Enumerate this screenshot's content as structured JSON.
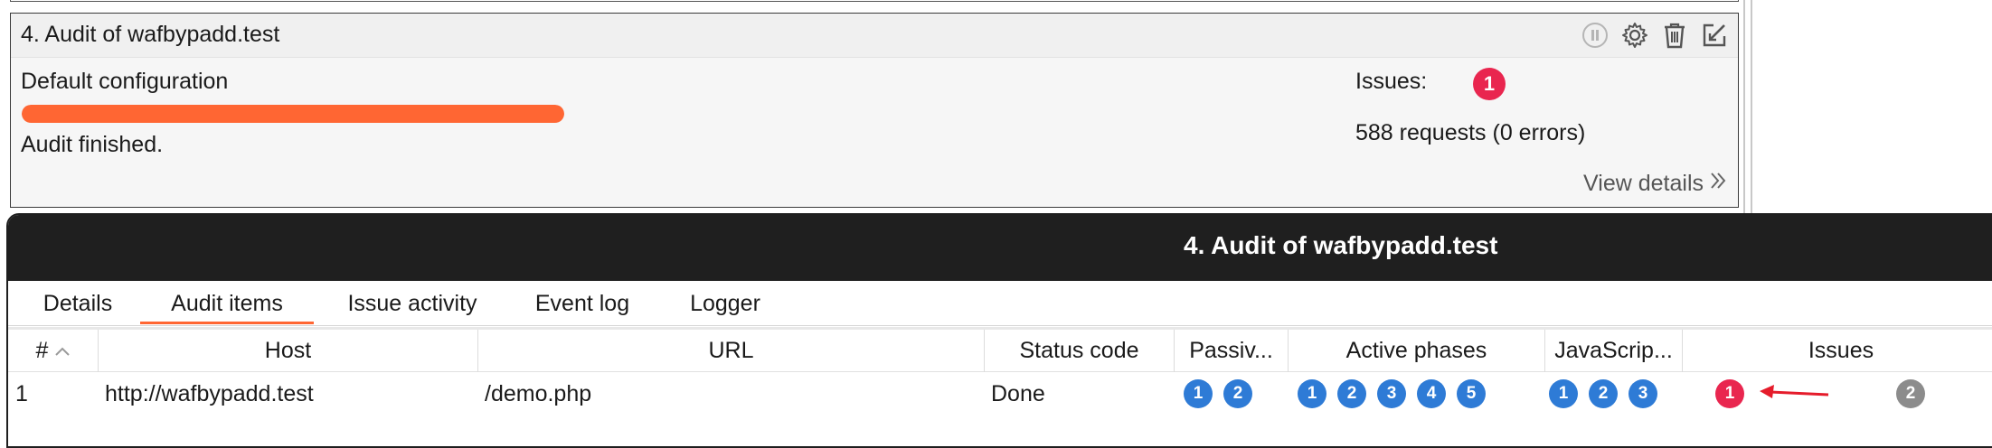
{
  "task_card": {
    "title": "4.  Audit of wafbypadd.test",
    "configuration": "Default configuration",
    "progress_fraction": 1.0,
    "progress_color": "#ff6633",
    "status": "Audit finished.",
    "issues_label": "Issues:",
    "issues_count": "1",
    "requests": "588 requests (0 errors)",
    "view_details": "View details",
    "icons": [
      "pause-icon",
      "gear-icon",
      "trash-icon",
      "edit-icon"
    ]
  },
  "dialog": {
    "title": "4. Audit of wafbypadd.test",
    "tabs": [
      {
        "label": "Details",
        "active": false
      },
      {
        "label": "Audit items",
        "active": true
      },
      {
        "label": "Issue activity",
        "active": false
      },
      {
        "label": "Event log",
        "active": false
      },
      {
        "label": "Logger",
        "active": false
      }
    ],
    "table": {
      "columns": [
        "#",
        "Host",
        "URL",
        "Status code",
        "Passiv...",
        "Active phases",
        "JavaScrip...",
        "Issues"
      ],
      "rows": [
        {
          "num": "1",
          "host": "http://wafbypadd.test",
          "url": "/demo.php",
          "status": "Done",
          "passive": [
            "1",
            "2"
          ],
          "active": [
            "1",
            "2",
            "3",
            "4",
            "5"
          ],
          "javascript": [
            "1",
            "2",
            "3"
          ],
          "issues_high": "1",
          "issues_other": "2"
        }
      ]
    }
  },
  "colors": {
    "accent": "#ff6633",
    "badge_blue": "#2e7bd6",
    "badge_red": "#e9264f",
    "badge_gray": "#8c8c8c",
    "titlebar": "#1f1f1f"
  }
}
